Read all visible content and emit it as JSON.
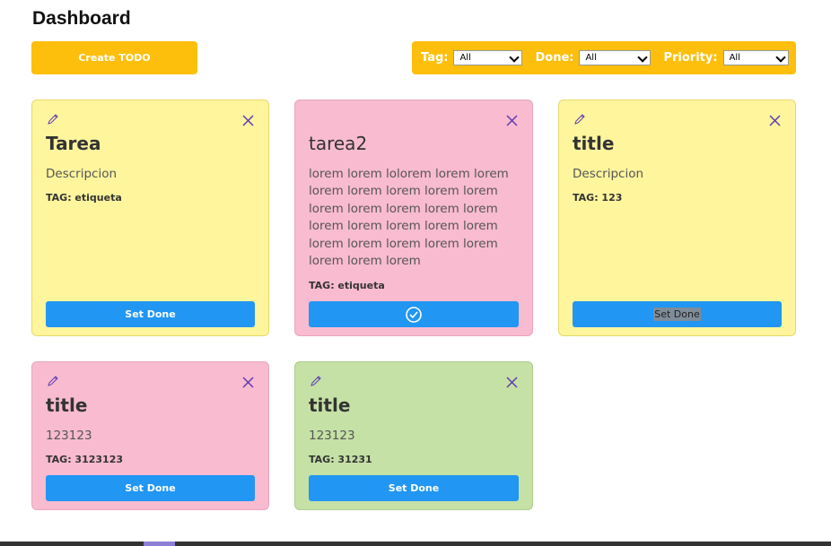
{
  "page": {
    "title": "Dashboard"
  },
  "toolbar": {
    "create_label": "Create TODO",
    "filters": [
      {
        "label": "Tag:",
        "value": "All"
      },
      {
        "label": "Done:",
        "value": "All"
      },
      {
        "label": "Priority:",
        "value": "All"
      }
    ]
  },
  "colors": {
    "accent": "#fdbf0b",
    "button": "#2196f3",
    "yellow_card": "#fef59d",
    "pink_card": "#f8bbd0",
    "green_card": "#c5e1a5",
    "icon": "#5e3bb0"
  },
  "cards": [
    {
      "title": "Tarea",
      "description": "Descripcion",
      "tag": "TAG: etiqueta",
      "button": "Set Done",
      "color": "yellow"
    },
    {
      "title": "tarea2",
      "description": "lorem lorem lolorem lorem lorem lorem lorem lorem lorem lorem lorem lorem lorem lorem lorem lorem lorem lorem lorem lorem lorem lorem lorem lorem lorem lorem lorem lorem",
      "tag": "TAG: etiqueta",
      "button_icon": "check-circle-icon",
      "color": "pink",
      "done": true
    },
    {
      "title": "title",
      "description": "Descripcion",
      "tag": "TAG: 123",
      "button": "Set Done",
      "color": "yellow"
    },
    {
      "title": "title",
      "description": "123123",
      "tag": "TAG: 3123123",
      "button": "Set Done",
      "color": "pink"
    },
    {
      "title": "title",
      "description": "123123",
      "tag": "TAG: 31231",
      "button": "Set Done",
      "color": "green"
    }
  ]
}
